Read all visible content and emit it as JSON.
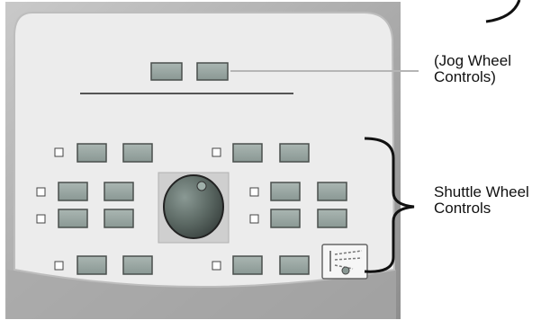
{
  "annotations": {
    "jog_wheel": {
      "line1": "(Jog Wheel",
      "line2": "Controls)"
    },
    "shuttle_wheel": {
      "line1": "Shuttle Wheel",
      "line2": "Controls"
    }
  },
  "colors": {
    "panel_fill": "#ececec",
    "panel_border": "#bdbdbd",
    "outer_frame": "#9a9a9a",
    "button_fill": "#9aa8a3",
    "button_border": "#4a4f4d",
    "knob_well": "#cfcfcf",
    "knob_fill": "#5f6d68",
    "leader_line": "#b5b5b5",
    "bracket": "#111111"
  },
  "icons": {
    "checkbox": "checkbox-icon",
    "knob": "shuttle-knob-icon",
    "settings_panel": "panel-settings-icon"
  }
}
